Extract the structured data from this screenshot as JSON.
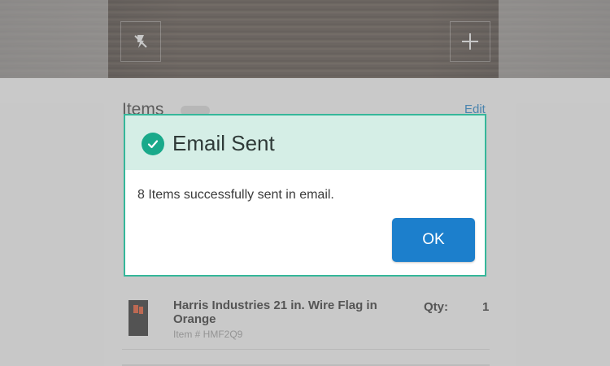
{
  "camera": {
    "flash_icon": "flash-off-icon",
    "add_icon": "plus-icon"
  },
  "list": {
    "title": "Items",
    "edit_label": "Edit",
    "visible_item": {
      "name": "Harris Industries 21 in. Wire Flag in Orange",
      "sku": "Item # HMF2Q9",
      "qty_label": "Qty:",
      "qty_value": "1"
    }
  },
  "dialog": {
    "title": "Email Sent",
    "icon": "check-circle-icon",
    "message": "8 Items successfully sent in email.",
    "ok_label": "OK",
    "accent_color": "#19a98a",
    "button_color": "#1c7fcc"
  }
}
